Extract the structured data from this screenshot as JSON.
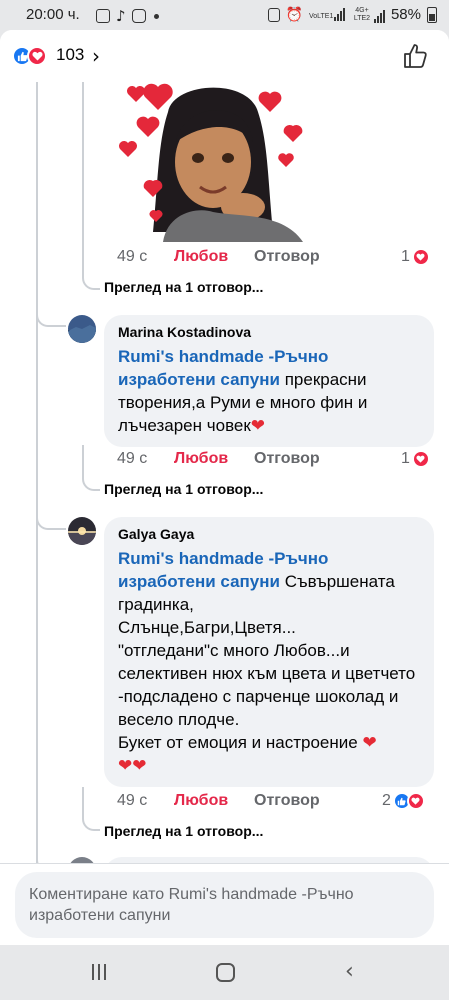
{
  "status_bar": {
    "time": "20:00 ч.",
    "battery": "58%",
    "network_1": "VoLTE1",
    "network_2": "4G+ LTE2"
  },
  "reactions_header": {
    "count": "103",
    "icons": [
      "like-icon",
      "love-icon"
    ]
  },
  "comments": [
    {
      "type": "sticker",
      "sticker_icon": "girl-with-hearts-sticker",
      "time": "49 с",
      "love_label": "Любов",
      "reply_label": "Отговор",
      "reaction_count": "1",
      "view_replies": "Преглед на 1 отговор..."
    },
    {
      "author": "Marina Kostadinova",
      "tag": "Rumi's handmade -Ръчно изработени сапуни",
      "text": " прекрасни творения,а Руми е много фин и лъчезарен човек",
      "emoji": "❤",
      "time": "49 с",
      "love_label": "Любов",
      "reply_label": "Отговор",
      "reaction_count": "1",
      "view_replies": "Преглед на 1 отговор..."
    },
    {
      "author": "Galya Gaya",
      "tag": "Rumi's handmade -Ръчно изработени сапуни",
      "text": " Съвършената градинка,\nСлънце,Багри,Цветя...\n\"отгледани\"с много Любов...и селективен нюх към цвета и цветчето -подсладено с парченце шоколад и весело плодче.\nБукет от емоция и настроение ",
      "emoji": "❤",
      "emoji_line": "❤❤",
      "time": "49 с",
      "love_label": "Любов",
      "reply_label": "Отговор",
      "reaction_count": "2",
      "view_replies": "Преглед на 1 отговор..."
    }
  ],
  "composer": {
    "placeholder": "Коментиране като Rumi's handmade -Ръчно изработени сапуни"
  },
  "colors": {
    "love_red": "#e4284a",
    "like_blue": "#1877f2",
    "tag_blue": "#1a66b8",
    "bubble_bg": "#f0f2f5"
  }
}
